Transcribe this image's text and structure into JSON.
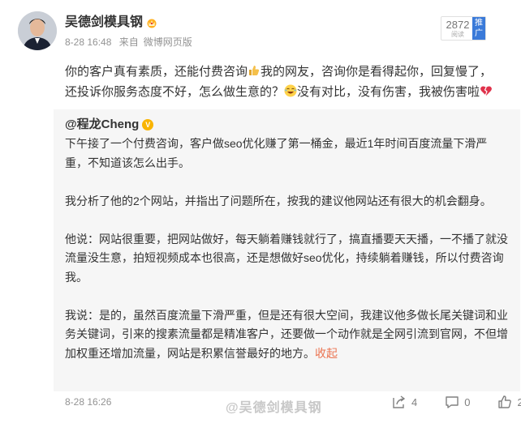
{
  "post": {
    "author": "吴德剑模具钢",
    "time": "8-28 16:48",
    "source_prefix": "来自",
    "source": "微博网页版",
    "views": {
      "count": "2872",
      "label": "阅读",
      "push": "推广"
    },
    "text_part1": "你的客户真有素质，还能付费咨询",
    "text_part2": "我的网友，咨询你是看得起你，回复慢了，还投诉你服务态度不好，怎么做生意的？",
    "text_part3": "没有对比，没有伤害，我被伤害啦"
  },
  "repost": {
    "author": "@程龙Cheng",
    "paragraphs": [
      "下午接了一个付费咨询，客户做seo优化赚了第一桶金，最近1年时间百度流量下滑严重，不知道该怎么出手。",
      "    我分析了他的2个网站，并指出了问题所在，按我的建议他网站还有很大的机会翻身。",
      "    他说：网站很重要，把网站做好，每天躺着赚钱就行了，搞直播要天天播，一不播了就没流量没生意，拍短视频成本也很高，还是想做好seo优化，持续躺着赚钱，所以付费咨询我。",
      "    我说：是的，虽然百度流量下滑严重，但是还有很大空间，我建议他多做长尾关键词和业务关键词，引来的搜素流量都是精准客户，还要做一个动作就是全网引流到官网，不但增加权重还增加流量，网站是积累信誉最好的地方。"
    ],
    "collapse": "收起",
    "time": "8-28 16:26",
    "watermark": "@吴德剑模具钢"
  },
  "actions": {
    "share": "4",
    "comment": "0",
    "like": "2"
  },
  "colors": {
    "accent": "#eb7350",
    "meta": "#939393",
    "repost_bg": "#f6f6f6"
  }
}
